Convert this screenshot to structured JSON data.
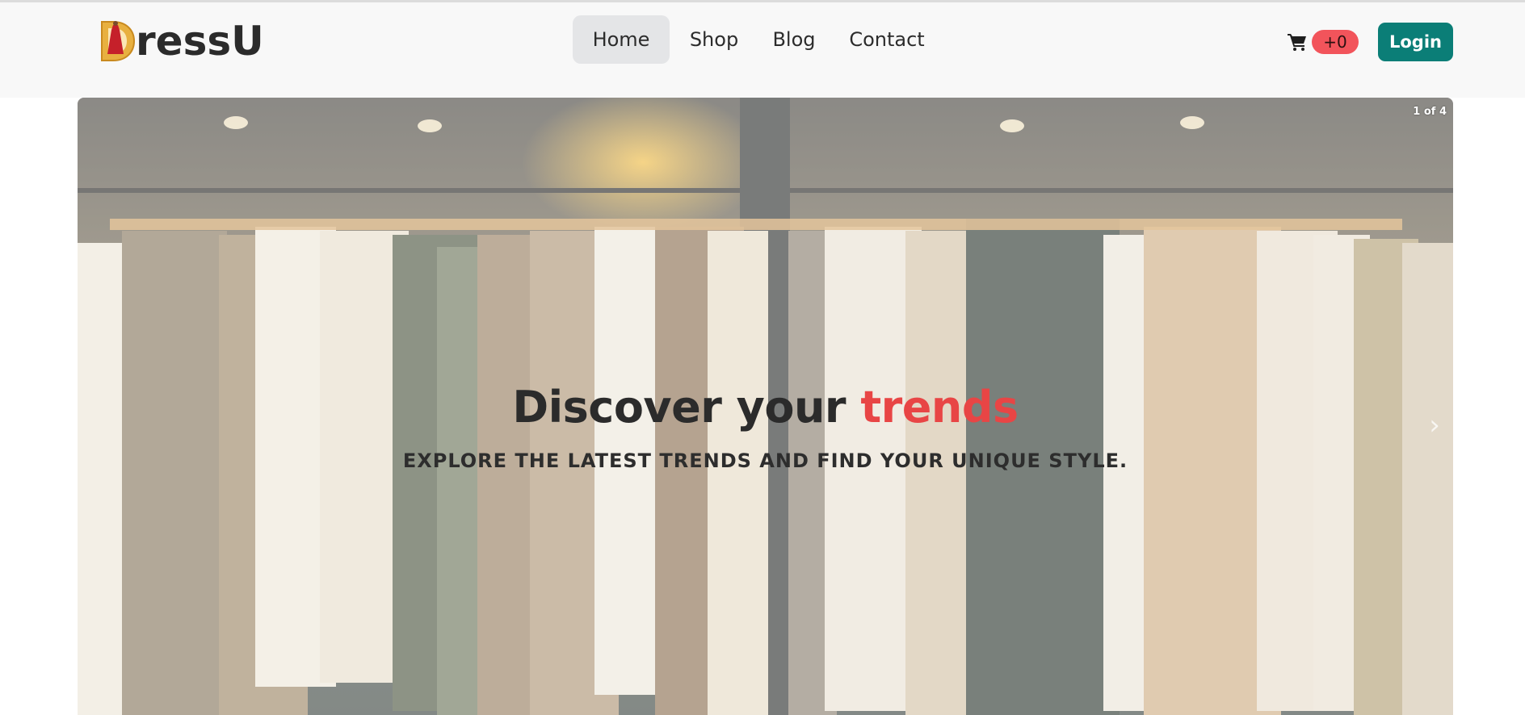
{
  "brand": {
    "name": "ressU",
    "logo_letter": "D",
    "accent_color": "#e84545"
  },
  "nav": {
    "items": [
      {
        "label": "Home",
        "active": true
      },
      {
        "label": "Shop",
        "active": false
      },
      {
        "label": "Blog",
        "active": false
      },
      {
        "label": "Contact",
        "active": false
      }
    ]
  },
  "cart": {
    "icon": "shopping-cart-icon",
    "count_label": "+0",
    "badge_color": "#f2545b"
  },
  "login": {
    "label": "Login",
    "color": "#0b7e77"
  },
  "hero": {
    "slide_counter": "1 of 4",
    "headline_main": "Discover your ",
    "headline_accent": "trends",
    "subheadline": "EXPLORE THE LATEST TRENDS AND FIND YOUR UNIQUE STYLE.",
    "next_icon": "chevron-right-icon",
    "background": "clothing-rack-photo"
  }
}
